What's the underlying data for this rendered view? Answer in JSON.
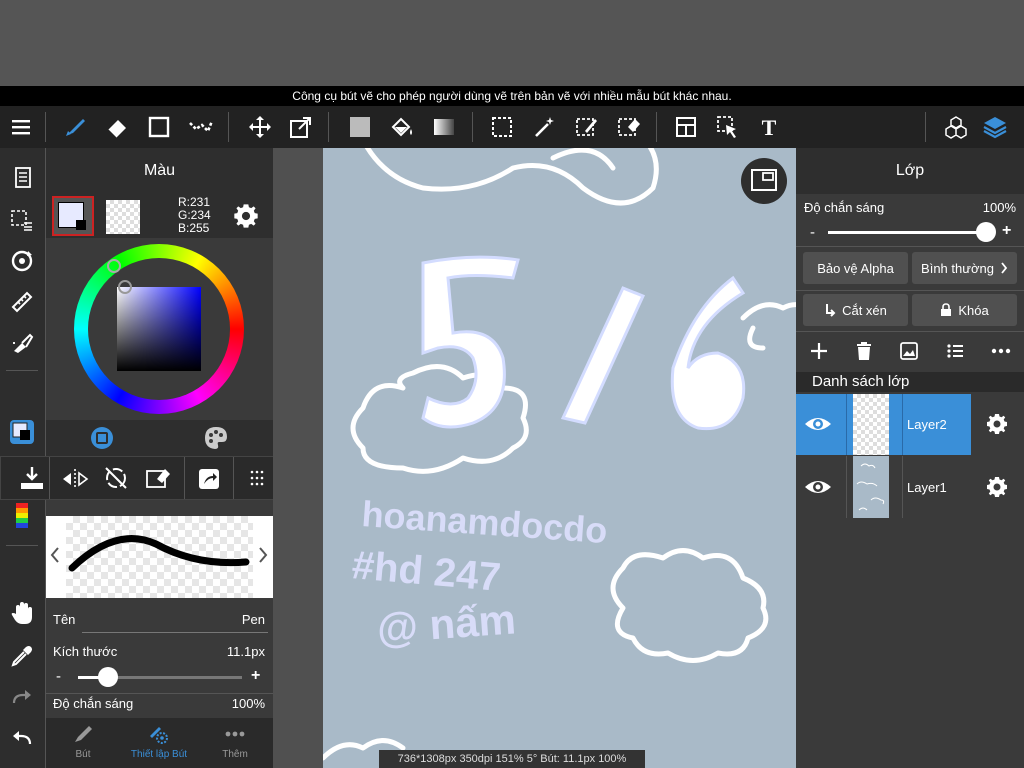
{
  "tip": "Công cụ bút vẽ cho phép người dùng vẽ trên bản vẽ với nhiều mẫu bút khác nhau.",
  "color_panel": {
    "title": "Màu",
    "rgb_r": "R:231",
    "rgb_g": "G:234",
    "rgb_b": "B:255"
  },
  "brush": {
    "name_label": "Tên",
    "name_value": "Pen",
    "size_label": "Kích thước",
    "size_value": "11.1px",
    "size_minus": "-",
    "size_plus": "+",
    "opacity_label": "Độ chắn sáng",
    "opacity_value": "100%",
    "size_fraction": 0.18
  },
  "bottom_tabs": {
    "brush": "Bút",
    "brush_settings": "Thiết lập Bút",
    "more": "Thêm"
  },
  "layers": {
    "title": "Lớp",
    "opacity_label": "Độ chắn sáng",
    "opacity_value": "100%",
    "opacity_minus": "-",
    "opacity_plus": "+",
    "opacity_fraction": 1.0,
    "alpha_protect": "Bảo vệ Alpha",
    "blend_mode": "Bình thường",
    "clipping": "Cắt xén",
    "lock": "Khóa",
    "list_title": "Danh sách lớp",
    "items": [
      {
        "name": "Layer2"
      },
      {
        "name": "Layer1"
      }
    ]
  },
  "canvas": {
    "status": "736*1308px 350dpi 151% 5° Bút: 11.1px 100%"
  },
  "colors": {
    "accent": "#3a8fd8",
    "selected_layer": "#3a8fd8",
    "canvas_bg": "#a9bac8",
    "primary_color": "#e7eaff"
  }
}
